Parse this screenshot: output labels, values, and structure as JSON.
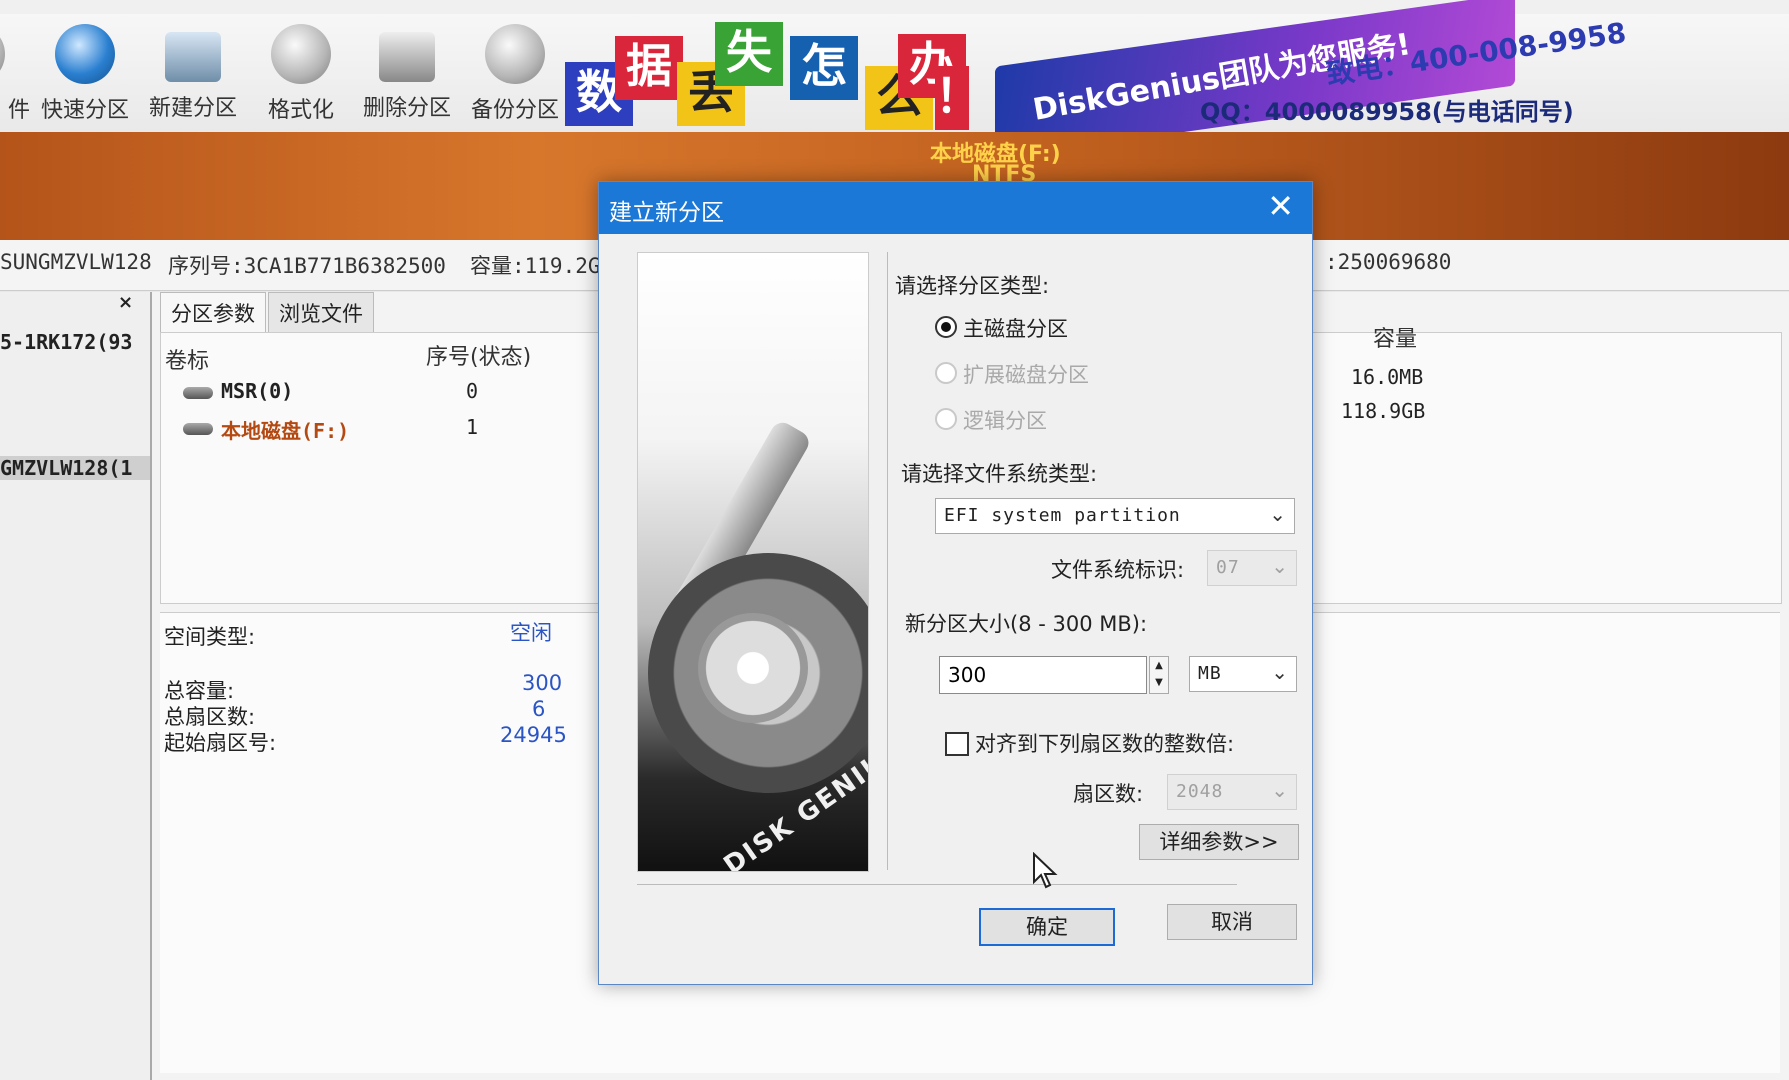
{
  "toolbar": {
    "items": [
      {
        "label": "件",
        "icon": "file-icon"
      },
      {
        "label": "快速分区",
        "icon": "quick-partition-icon"
      },
      {
        "label": "新建分区",
        "icon": "new-partition-icon"
      },
      {
        "label": "格式化",
        "icon": "format-icon"
      },
      {
        "label": "删除分区",
        "icon": "delete-partition-icon"
      },
      {
        "label": "备份分区",
        "icon": "backup-partition-icon"
      }
    ]
  },
  "banner": {
    "chars": [
      "数",
      "据",
      "丢",
      "失",
      "怎",
      "么",
      "办",
      "！"
    ],
    "brand_text": "DiskGenius团队为您服务!",
    "phone": "致电：400-008-9958",
    "qq": "QQ：4000089958(与电话同号)"
  },
  "disk_bar": {
    "name": "本地磁盘(F:)",
    "fs": "NTFS"
  },
  "info_strip": {
    "model": "SUNGMZVLW128",
    "serial": "序列号:3CA1B771B6382500",
    "capacity": "容量:119.2G",
    "sectors": ":250069680"
  },
  "tree": {
    "items": [
      "5-1RK172(93",
      "GMZVLW128(1"
    ],
    "close": "×"
  },
  "tabs": [
    "分区参数",
    "浏览文件"
  ],
  "table": {
    "headers": {
      "label": "卷标",
      "index": "序号(状态)",
      "capacity": "容量"
    },
    "rows": [
      {
        "label": "MSR(0)",
        "index": "0",
        "capacity": "16.0MB"
      },
      {
        "label": "本地磁盘(F:)",
        "index": "1",
        "capacity": "118.9GB"
      }
    ]
  },
  "details": {
    "space_type_label": "空间类型:",
    "space_type_value": "空闲",
    "total_capacity_label": "总容量:",
    "total_capacity_value": "300",
    "total_sectors_label": "总扇区数:",
    "total_sectors_value": "6",
    "start_sector_label": "起始扇区号:",
    "start_sector_value": "24945"
  },
  "dialog": {
    "title": "建立新分区",
    "close": "✕",
    "partition_type_label": "请选择分区类型:",
    "partition_types": [
      {
        "label": "主磁盘分区",
        "selected": true,
        "enabled": true
      },
      {
        "label": "扩展磁盘分区",
        "selected": false,
        "enabled": false
      },
      {
        "label": "逻辑分区",
        "selected": false,
        "enabled": false
      }
    ],
    "fs_type_label": "请选择文件系统类型:",
    "fs_type_value": "EFI system partition",
    "fs_id_label": "文件系统标识:",
    "fs_id_value": "07",
    "size_label": "新分区大小(8 - 300 MB):",
    "size_value": "300",
    "size_unit": "MB",
    "align_label": "对齐到下列扇区数的整数倍:",
    "align_checked": false,
    "sector_label": "扇区数:",
    "sector_value": "2048",
    "advanced_button": "详细参数>>",
    "ok_button": "确定",
    "cancel_button": "取消",
    "image_text": "DISK GENIUS"
  }
}
